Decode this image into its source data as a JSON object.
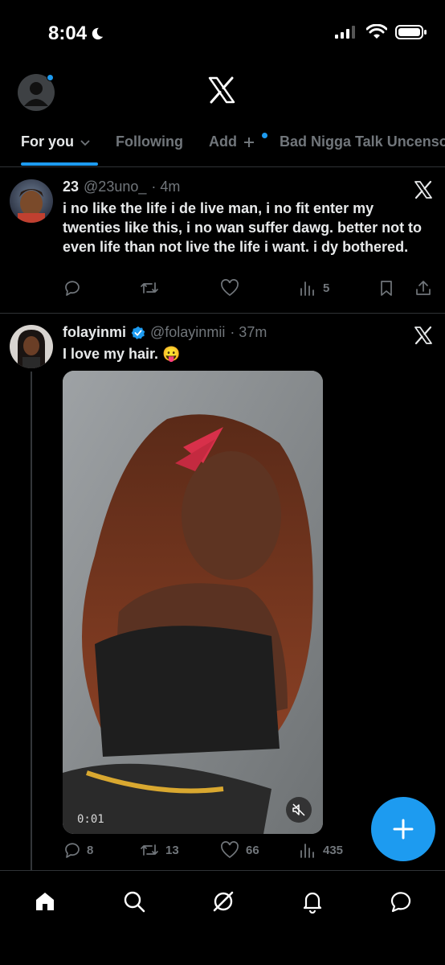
{
  "status_bar": {
    "time": "8:04"
  },
  "tabs": [
    {
      "label": "For you"
    },
    {
      "label": "Following"
    },
    {
      "label": "Add"
    },
    {
      "label": "Bad Nigga Talk Uncensored"
    }
  ],
  "posts": [
    {
      "name": "23",
      "handle": "@23uno_",
      "time": "· 4m",
      "text": "i no like the life i de live man, i no fit enter my twenties like this, i no wan suffer dawg. better not to even life than not live the life i want. i dy bothered.",
      "replies": "",
      "reposts": "",
      "likes": "",
      "views": "5"
    },
    {
      "name": "folayinmi",
      "handle": "@folayinmii",
      "time": "· 37m",
      "text": "I love my hair.",
      "emoji": "😛",
      "video_time": "0:01",
      "replies": "8",
      "reposts": "13",
      "likes": "66",
      "views": "435"
    }
  ],
  "colors": {
    "accent": "#1d9bf0",
    "background": "#000000",
    "muted": "#71767b"
  },
  "icons": [
    "profile-avatar-icon",
    "x-logo-icon",
    "close-x-icon",
    "reply-icon",
    "repost-icon",
    "like-icon",
    "views-icon",
    "bookmark-icon",
    "share-icon",
    "mute-icon",
    "compose-plus-icon",
    "home-icon",
    "search-icon",
    "grok-icon",
    "notifications-icon",
    "messages-icon"
  ]
}
